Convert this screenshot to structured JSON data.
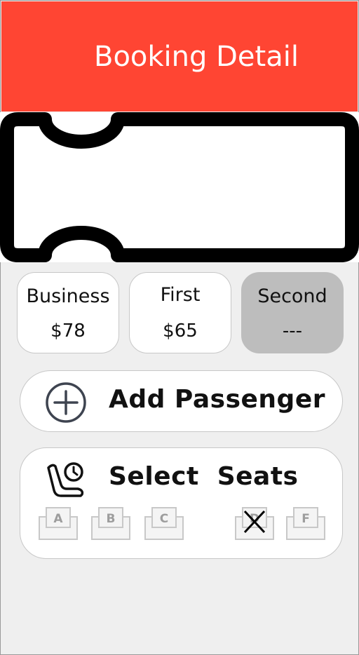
{
  "header": {
    "title": "Booking Detail",
    "background": "#ff4533"
  },
  "fare_classes": [
    {
      "name": "Business",
      "price": "$78",
      "selected": false
    },
    {
      "name": "First",
      "price": "$65",
      "selected": false
    },
    {
      "name": "Second",
      "price": "---",
      "selected": true
    }
  ],
  "add_passenger": {
    "label": "Add Passenger",
    "icon": "plus-circle-icon"
  },
  "select_seats": {
    "label": "Select  Seats",
    "icon": "seat-clock-icon",
    "seats": [
      {
        "label": "A",
        "taken": false
      },
      {
        "label": "B",
        "taken": false
      },
      {
        "label": "C",
        "taken": false
      },
      {
        "label": "D",
        "taken": true
      },
      {
        "label": "F",
        "taken": false
      }
    ]
  }
}
